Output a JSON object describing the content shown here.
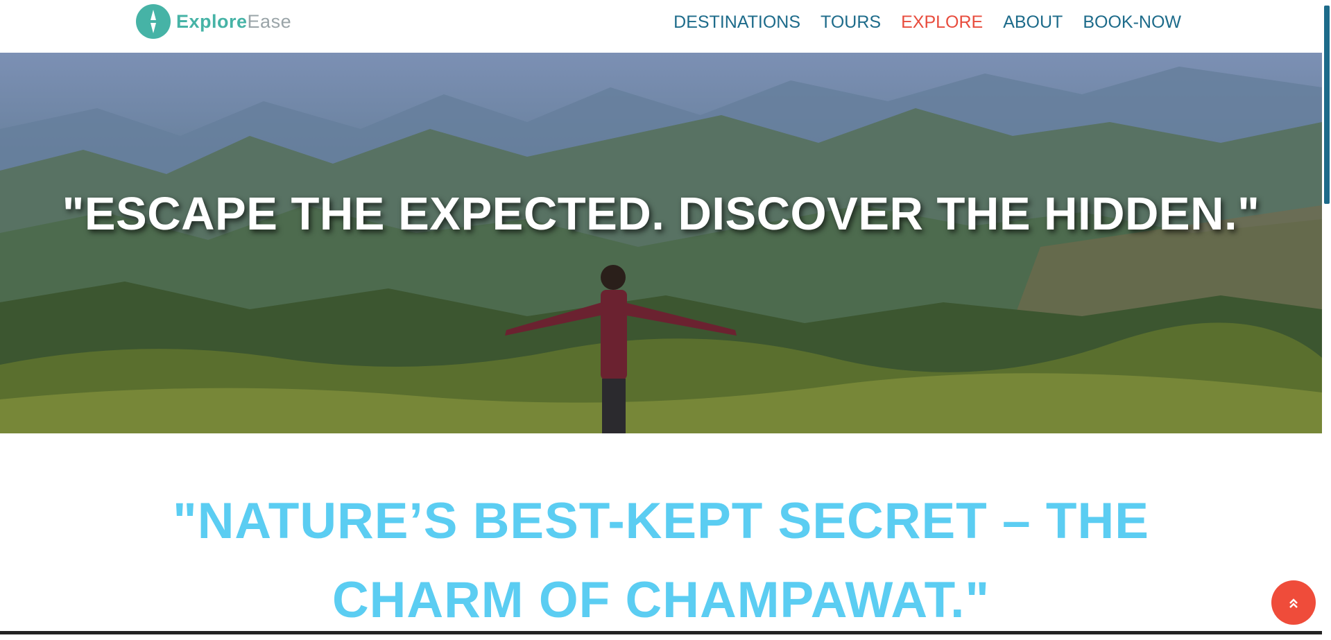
{
  "brand": {
    "part1": "Explore",
    "part2": "Ease",
    "icon": "compass-icon"
  },
  "nav": {
    "items": [
      {
        "label": "DESTINATIONS",
        "active": false
      },
      {
        "label": "TOURS",
        "active": false
      },
      {
        "label": "EXPLORE",
        "active": true
      },
      {
        "label": "ABOUT",
        "active": false
      },
      {
        "label": "BOOK-NOW",
        "active": false
      }
    ]
  },
  "hero": {
    "quote": "\"ESCAPE THE EXPECTED. DISCOVER THE HIDDEN.\""
  },
  "section": {
    "line1": "\"NATURE’S BEST-KEPT SECRET – THE",
    "line2": "CHARM OF CHAMPAWAT.\""
  },
  "scroll_top": {
    "icon": "double-chevron-up-icon",
    "symbol": "⌃"
  },
  "colors": {
    "brand": "#46b3a6",
    "nav": "#1d6b8a",
    "nav_active": "#e84c3d",
    "heading": "#5bcdf2",
    "scroll_button": "#ef4c3a"
  }
}
